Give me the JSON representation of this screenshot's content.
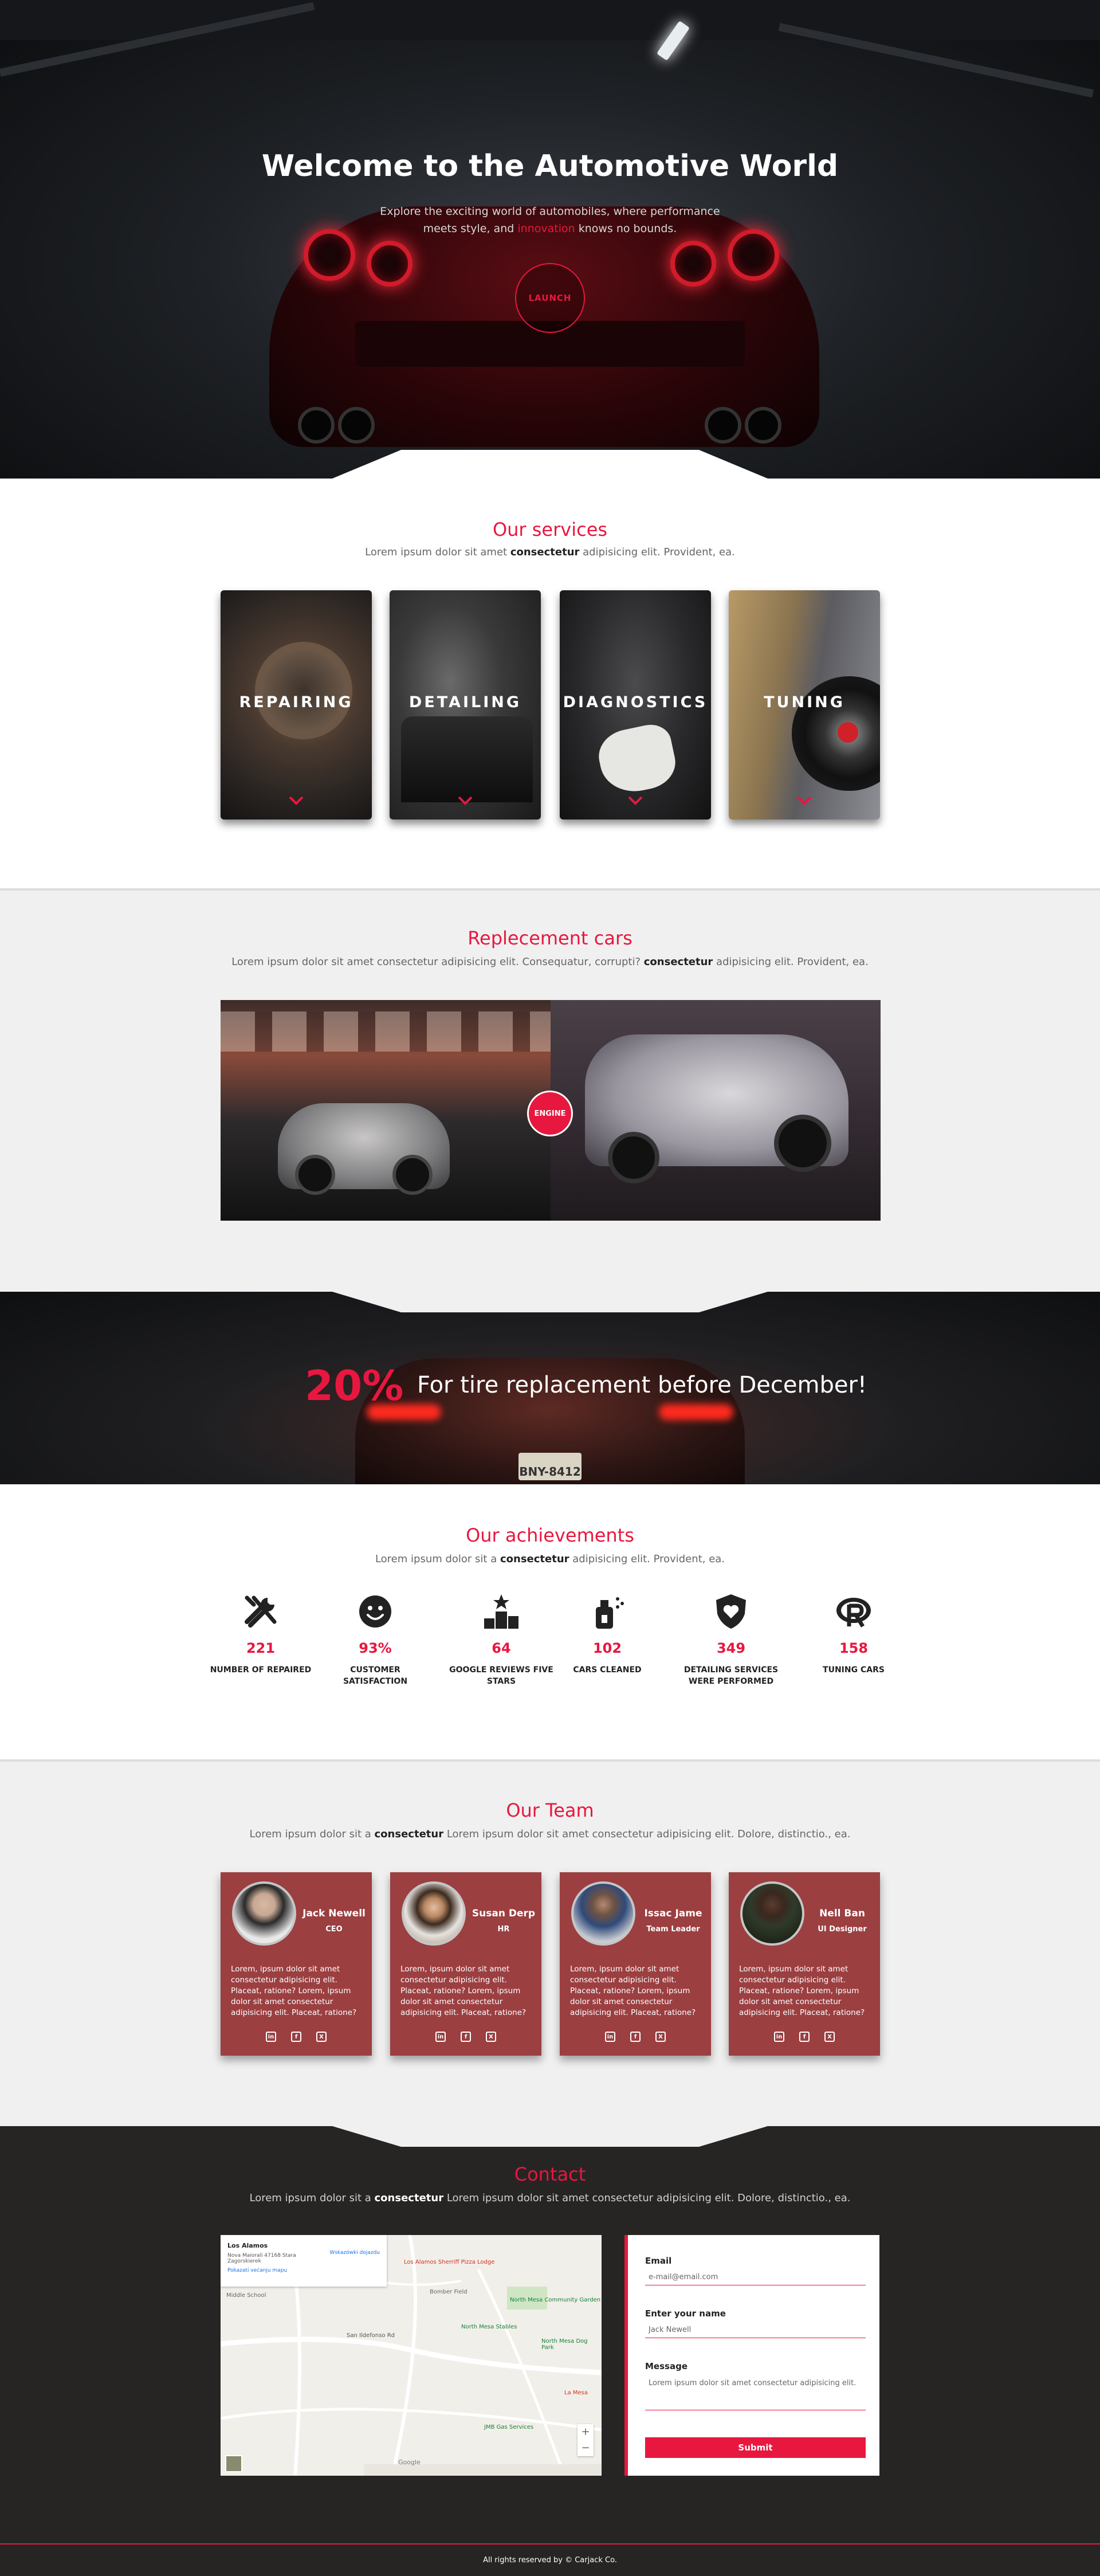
{
  "hero": {
    "title": "Welcome to the Automotive World",
    "subtitle_part1": "Explore the exciting world of automobiles, where performance meets style, and",
    "subtitle_highlight": "innovation",
    "subtitle_part2": "knows no bounds.",
    "launch_label": "LAUNCH"
  },
  "services": {
    "title": "Our services",
    "subtitle_pre": "Lorem ipsum dolor sit amet",
    "subtitle_bold": "consectetur",
    "subtitle_post": "adipisicing elit. Provident, ea.",
    "items": [
      {
        "label": "REPAIRING"
      },
      {
        "label": "DETAILING"
      },
      {
        "label": "DIAGNOSTICS"
      },
      {
        "label": "TUNING"
      }
    ]
  },
  "replacement": {
    "title": "Replecement cars",
    "subtitle_pre": "Lorem ipsum dolor sit amet consectetur adipisicing elit. Consequatur, corrupti?",
    "subtitle_bold": "consectetur",
    "subtitle_post": "adipisicing elit. Provident, ea.",
    "engine_label": "ENGINE"
  },
  "promo": {
    "percent": "20%",
    "text": "For tire replacement before December!",
    "plate": "BNY-8412"
  },
  "achievements": {
    "title": "Our achievements",
    "subtitle_pre": "Lorem ipsum dolor sit a",
    "subtitle_bold": "consectetur",
    "subtitle_post": "adipisicing elit. Provident, ea.",
    "items": [
      {
        "icon": "tools-icon",
        "value": "221",
        "label": "NUMBER OF REPAIRED"
      },
      {
        "icon": "smiley-icon",
        "value": "93%",
        "label": "CUSTOMER SATISFACTION"
      },
      {
        "icon": "podium-star-icon",
        "value": "64",
        "label": "GOOGLE REVIEWS FIVE STARS"
      },
      {
        "icon": "spray-bottle-icon",
        "value": "102",
        "label": "CARS CLEANED"
      },
      {
        "icon": "shield-heart-icon",
        "value": "349",
        "label": "DETAILING SERVICES WERE PERFORMED"
      },
      {
        "icon": "r-badge-icon",
        "value": "158",
        "label": "TUNING CARS"
      }
    ]
  },
  "team": {
    "title": "Our Team",
    "subtitle_pre": "Lorem ipsum dolor sit a",
    "subtitle_bold": "consectetur",
    "subtitle_post": "Lorem ipsum dolor sit amet consectetur adipisicing elit. Dolore, distinctio., ea.",
    "members": [
      {
        "name": "Jack Newell",
        "role": "CEO",
        "bio": "Lorem, ipsum dolor sit amet consectetur adipisicing elit. Placeat, ratione? Lorem, ipsum dolor sit amet consectetur adipisicing elit. Placeat, ratione?"
      },
      {
        "name": "Susan Derp",
        "role": "HR",
        "bio": "Lorem, ipsum dolor sit amet consectetur adipisicing elit. Placeat, ratione? Lorem, ipsum dolor sit amet consectetur adipisicing elit. Placeat, ratione?"
      },
      {
        "name": "Issac Jame",
        "role": "Team Leader",
        "bio": "Lorem, ipsum dolor sit amet consectetur adipisicing elit. Placeat, ratione? Lorem, ipsum dolor sit amet consectetur adipisicing elit. Placeat, ratione?"
      },
      {
        "name": "Nell Ban",
        "role": "UI Designer",
        "bio": "Lorem, ipsum dolor sit amet consectetur adipisicing elit. Placeat, ratione? Lorem, ipsum dolor sit amet consectetur adipisicing elit. Placeat, ratione?"
      }
    ],
    "social": [
      "in",
      "f",
      "X"
    ]
  },
  "contact": {
    "title": "Contact",
    "subtitle_pre": "Lorem ipsum dolor sit a",
    "subtitle_bold": "consectetur",
    "subtitle_post": "Lorem ipsum dolor sit amet consectetur adipisicing elit. Dolore, distinctio., ea.",
    "map": {
      "place_title": "Los Alamos",
      "place_address": "Nova Maiorali 47168 Stara Zagorskierek",
      "place_link": "Pokazati većanju mapu",
      "directions": "Wskazówki dojazdu",
      "labels": [
        "Los Alamos Sherriff Pizza Lodge",
        "Bomber Field",
        "North Mesa Community Garden",
        "North Mesa Dog Park",
        "North Mesa Stables",
        "JMB Gas Services",
        "Middle School",
        "La Mesa",
        "San Ildefonso Rd",
        "Google"
      ],
      "zoom_in": "+",
      "zoom_out": "−"
    },
    "form": {
      "email_label": "Email",
      "email_value": "e-mail@email.com",
      "name_label": "Enter your name",
      "name_value": "Jack Newell",
      "message_label": "Message",
      "message_value": "Lorem ipsum dolor sit amet consectetur adipisicing elit.",
      "submit_label": "Submit"
    }
  },
  "footer": {
    "text": "All rights reserved by © Carjack Co."
  },
  "colors": {
    "accent": "#e8173f",
    "team_card": "#9b3f41",
    "footer_bg": "#262524",
    "section_gray": "#f0f0f0"
  }
}
